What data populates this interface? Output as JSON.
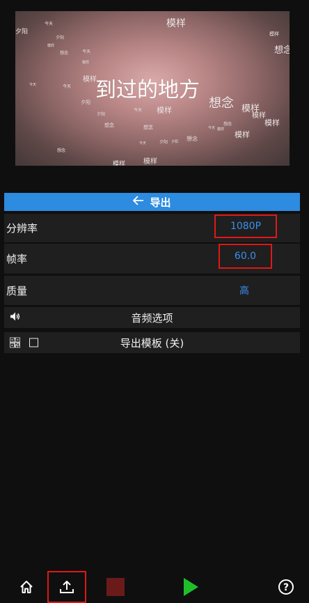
{
  "preview": {
    "title": "到过的地方",
    "words": {
      "w01": "模样",
      "w02": "夕阳",
      "w03": "今天",
      "w04": "夕阳",
      "w05": "模样",
      "w06": "想念",
      "w07": "想念",
      "w08": "今天",
      "w09": "夕阳",
      "w10": "模样",
      "w11": "今天",
      "w12": "模样",
      "w13": "想念",
      "w14": "夕阳",
      "w15": "今天",
      "w16": "模样",
      "w17": "想念",
      "w18": "模样",
      "w19": "模样",
      "w20": "模样",
      "w21": "想念",
      "w22": "想念",
      "w23": "模样",
      "w24": "今天",
      "w25": "夕阳",
      "w26": "想念",
      "w27": "模样",
      "w28": "想念",
      "w29": "模样",
      "w30": "模样",
      "w31": "夕阳",
      "w32": "今天",
      "w33": "今天",
      "w34": "模样"
    }
  },
  "header": {
    "back_icon": "arrow-left-icon",
    "title": "导出"
  },
  "settings": {
    "resolution": {
      "label": "分辨率",
      "value": "1080P"
    },
    "framerate": {
      "label": "帧率",
      "value": "60.0"
    },
    "quality": {
      "label": "质量",
      "value": "高"
    },
    "audio": {
      "icon": "speaker-icon",
      "label": "音频选项"
    },
    "template": {
      "icon": "qr-code-icon",
      "checked": false,
      "label": "导出模板 (关)"
    }
  },
  "toolbar": {
    "icons": [
      "home-icon",
      "export-upload-icon",
      "stop-icon",
      "play-icon",
      "help-icon"
    ],
    "colors": {
      "stop": "#6b1a1a",
      "play": "#1fbf2b",
      "accent": "#2d8be0",
      "highlight": "#e01818"
    }
  }
}
